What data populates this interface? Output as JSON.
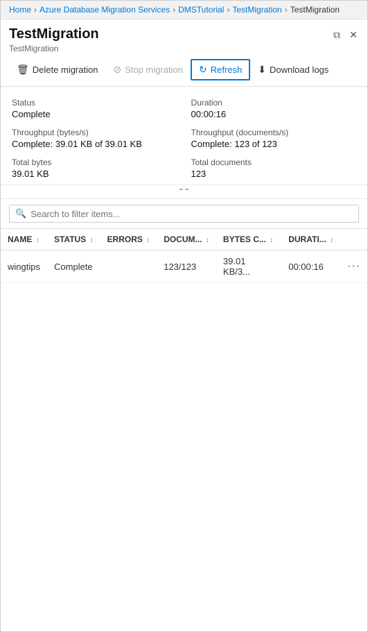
{
  "breadcrumb": {
    "items": [
      {
        "label": "Home",
        "active": true
      },
      {
        "label": "Azure Database Migration Services",
        "active": true
      },
      {
        "label": "DMSTutorial",
        "active": true
      },
      {
        "label": "TestMigration",
        "active": true
      },
      {
        "label": "TestMigration",
        "active": false
      }
    ]
  },
  "page": {
    "title": "TestMigration",
    "subtitle": "TestMigration"
  },
  "toolbar": {
    "delete_label": "Delete migration",
    "stop_label": "Stop migration",
    "refresh_label": "Refresh",
    "download_label": "Download logs"
  },
  "stats": {
    "status_label": "Status",
    "status_value": "Complete",
    "duration_label": "Duration",
    "duration_value": "00:00:16",
    "throughput_bytes_label": "Throughput (bytes/s)",
    "throughput_bytes_value": "Complete: 39.01 KB of 39.01 KB",
    "throughput_docs_label": "Throughput (documents/s)",
    "throughput_docs_value": "Complete: 123 of 123",
    "total_bytes_label": "Total bytes",
    "total_bytes_value": "39.01 KB",
    "total_docs_label": "Total documents",
    "total_docs_value": "123"
  },
  "search": {
    "placeholder": "Search to filter items..."
  },
  "table": {
    "columns": [
      {
        "key": "name",
        "label": "NAME"
      },
      {
        "key": "status",
        "label": "STATUS"
      },
      {
        "key": "errors",
        "label": "ERRORS"
      },
      {
        "key": "documents",
        "label": "DOCUM..."
      },
      {
        "key": "bytes",
        "label": "BYTES C..."
      },
      {
        "key": "duration",
        "label": "DURATI..."
      }
    ],
    "rows": [
      {
        "name": "wingtips",
        "status": "Complete",
        "errors": "",
        "documents": "123/123",
        "bytes": "39.01 KB/3...",
        "duration": "00:00:16"
      }
    ]
  },
  "icons": {
    "delete": "🗑",
    "stop": "⊘",
    "refresh": "↻",
    "download": "⬇",
    "search": "🔍",
    "collapse": "⌃⌃",
    "sort": "↕",
    "ellipsis": "..."
  }
}
